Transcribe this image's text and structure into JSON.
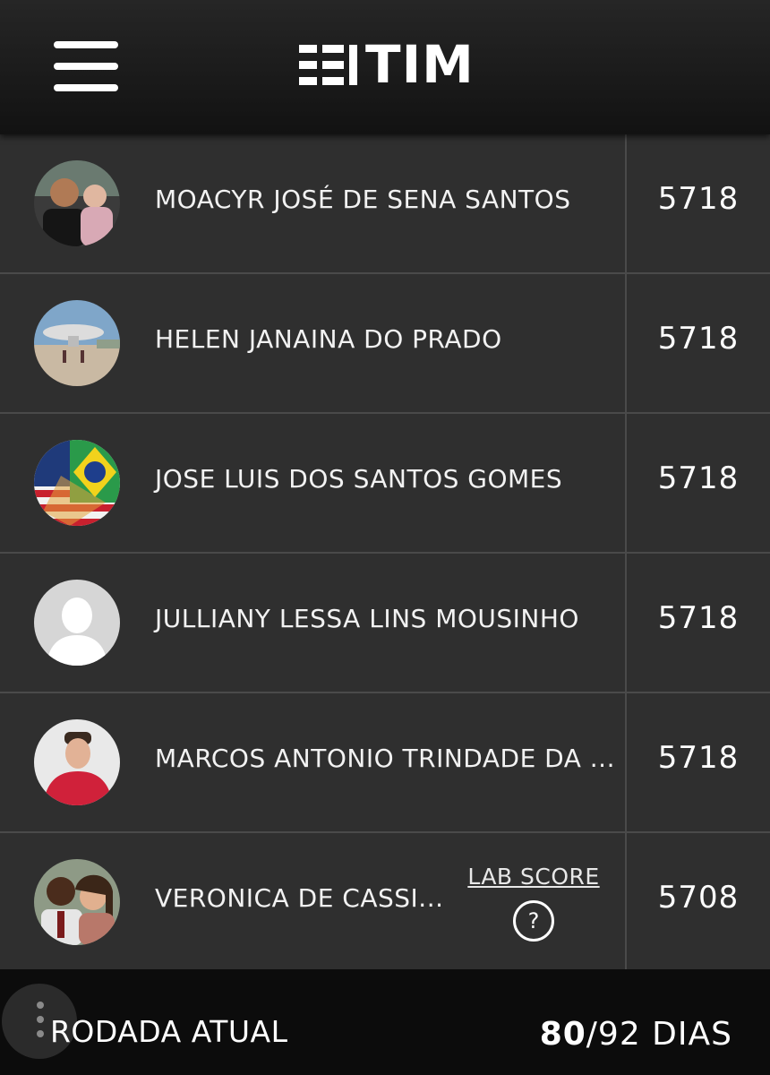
{
  "header": {
    "menu_icon": "hamburger-menu-icon",
    "logo_text": "TIM"
  },
  "ranking": [
    {
      "name": "MOACYR JOSÉ DE SENA SANTOS",
      "score": "5718",
      "avatar": "photo"
    },
    {
      "name": "HELEN JANAINA DO PRADO",
      "score": "5718",
      "avatar": "photo"
    },
    {
      "name": "JOSE LUIS DOS SANTOS GOMES",
      "score": "5718",
      "avatar": "photo"
    },
    {
      "name": "JULLIANY LESSA LINS MOUSINHO",
      "score": "5718",
      "avatar": "default-silhouette"
    },
    {
      "name": "MARCOS ANTONIO TRINDADE DA ...",
      "score": "5718",
      "avatar": "photo"
    },
    {
      "name": "VERONICA DE CASSI...",
      "score": "5708",
      "avatar": "photo"
    }
  ],
  "lab_score": {
    "label": "LAB SCORE",
    "help_icon_text": "?"
  },
  "footer": {
    "label": "RODADA ATUAL",
    "days_current": "80",
    "days_total": "/92 DIAS"
  },
  "colors": {
    "background": "#2f2f2f",
    "header": "#1a1a1a",
    "footer": "#0c0c0c",
    "text": "#ffffff",
    "divider": "#4a4a4a"
  }
}
